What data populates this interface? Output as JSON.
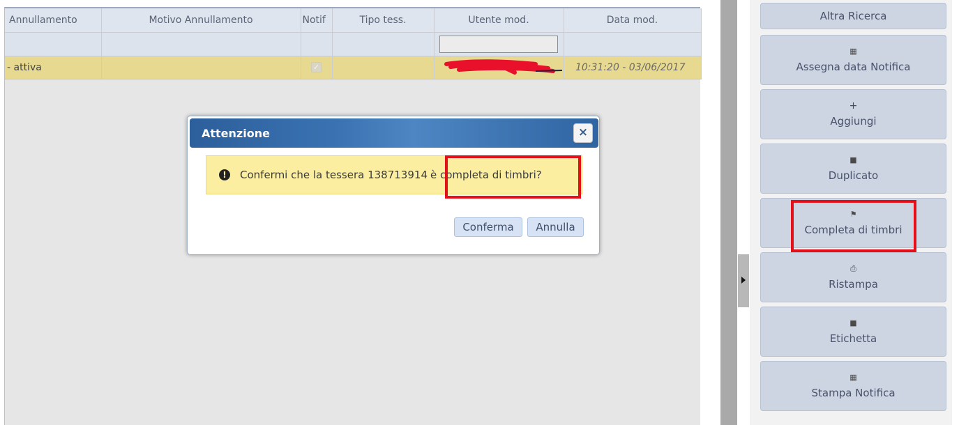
{
  "grid": {
    "columns": [
      "Annullamento",
      "Motivo Annullamento",
      "Notif",
      "Tipo tess.",
      "Utente mod.",
      "Data mod."
    ],
    "rows": [
      {
        "annullamento": "- attiva",
        "motivo": "",
        "notif_checked": true,
        "tipo": "",
        "utente": "",
        "data": "10:31:20 - 03/06/2017"
      }
    ]
  },
  "dialog": {
    "title": "Attenzione",
    "close_icon": "×",
    "message_prefix": "Confermi che la tessera 138713914",
    "message_highlight": "è completa di timbri?",
    "confirm_label": "Conferma",
    "cancel_label": "Annulla"
  },
  "actions": [
    {
      "label": "Altra Ricerca",
      "icon": ""
    },
    {
      "label": "Assegna data Notifica",
      "icon": "calendar-icon"
    },
    {
      "label": "Aggiungi",
      "icon": "plus-icon"
    },
    {
      "label": "Duplicato",
      "icon": "copy-icon"
    },
    {
      "label": "Completa di timbri",
      "icon": "flag-icon"
    },
    {
      "label": "Ristampa",
      "icon": "print-icon"
    },
    {
      "label": "Etichetta",
      "icon": "file-icon"
    },
    {
      "label": "Stampa Notifica",
      "icon": "calendar-icon"
    }
  ],
  "colors": {
    "highlight": "#e3101a",
    "selected_row": "#e7d98f",
    "dialog_header": "#2c5f9b",
    "action_button": "#cdd5e3"
  }
}
